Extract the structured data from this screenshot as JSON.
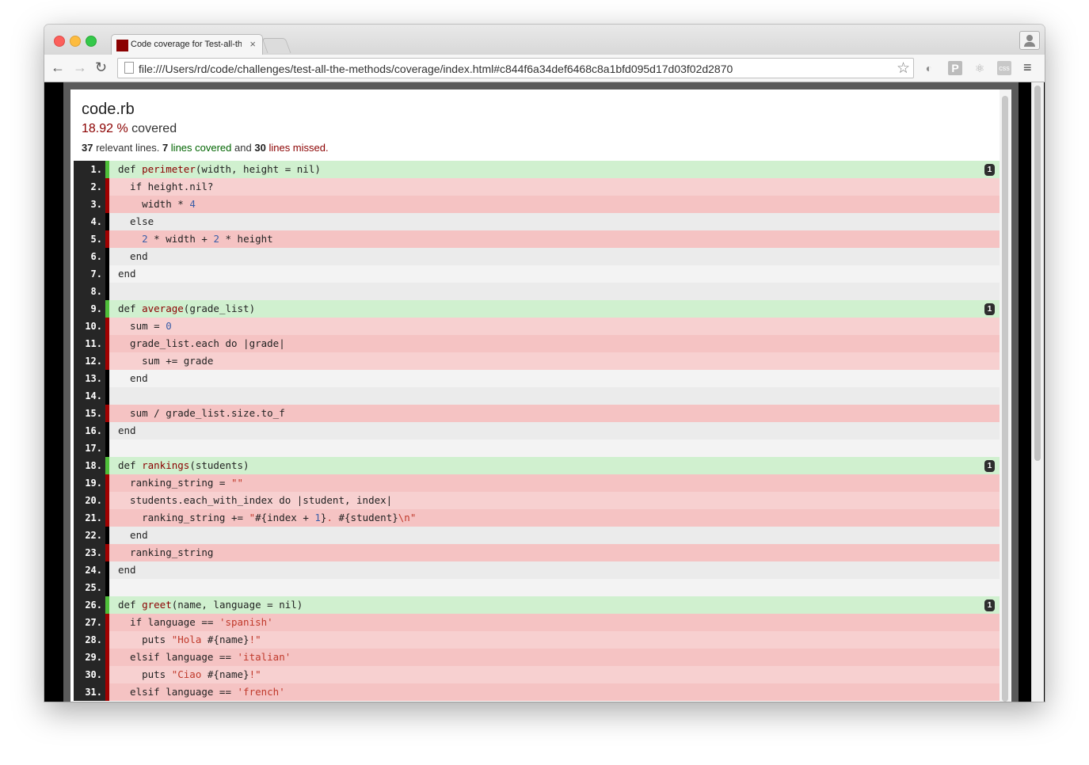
{
  "browser": {
    "tab_title": "Code coverage for Test-all-the-methods",
    "tab_close": "×",
    "url": "file:///Users/rd/code/challenges/test-all-the-methods/coverage/index.html#c844f6a34def6468c8a1bfd095d17d03f02d2870",
    "back": "←",
    "forward": "→",
    "reload": "↻",
    "star": "☆",
    "menu": "≡",
    "ext_opera": "◐",
    "ext_p": "P",
    "ext_react": "⚛",
    "ext_css": "css"
  },
  "report": {
    "file_name": "code.rb",
    "percent": "18.92 %",
    "covered_word": "covered",
    "relevant_count": "37",
    "relevant_text": "relevant lines.",
    "covered_count": "7",
    "covered_text": "lines covered",
    "and_text": "and",
    "missed_count": "30",
    "missed_text": "lines missed."
  },
  "colors": {
    "covered": "#d0f0cf",
    "missed": "#f5c3c3",
    "percent": "#8b0000",
    "covered_text": "#006400"
  },
  "lines": [
    {
      "n": "1.",
      "status": "covered",
      "hits": "1",
      "code": "def <span class=\"kw-fn\">perimeter</span>(width, height = nil)"
    },
    {
      "n": "2.",
      "status": "missed",
      "code": "  if height.nil?"
    },
    {
      "n": "3.",
      "status": "missed",
      "code": "    width * <span class=\"num\">4</span>"
    },
    {
      "n": "4.",
      "status": "never",
      "code": "  else"
    },
    {
      "n": "5.",
      "status": "missed",
      "code": "    <span class=\"num\">2</span> * width + <span class=\"num\">2</span> * height"
    },
    {
      "n": "6.",
      "status": "never",
      "code": "  end"
    },
    {
      "n": "7.",
      "status": "never",
      "code": "end"
    },
    {
      "n": "8.",
      "status": "never",
      "code": ""
    },
    {
      "n": "9.",
      "status": "covered",
      "hits": "1",
      "code": "def <span class=\"kw-fn\">average</span>(grade_list)"
    },
    {
      "n": "10.",
      "status": "missed",
      "code": "  sum = <span class=\"num\">0</span>"
    },
    {
      "n": "11.",
      "status": "missed",
      "code": "  grade_list.each do |grade|"
    },
    {
      "n": "12.",
      "status": "missed",
      "code": "    sum += grade"
    },
    {
      "n": "13.",
      "status": "never",
      "code": "  end"
    },
    {
      "n": "14.",
      "status": "never",
      "code": ""
    },
    {
      "n": "15.",
      "status": "missed",
      "code": "  sum / grade_list.size.to_f"
    },
    {
      "n": "16.",
      "status": "never",
      "code": "end"
    },
    {
      "n": "17.",
      "status": "never",
      "code": ""
    },
    {
      "n": "18.",
      "status": "covered",
      "hits": "1",
      "code": "def <span class=\"kw-fn\">rankings</span>(students)"
    },
    {
      "n": "19.",
      "status": "missed",
      "code": "  ranking_string = <span class=\"str\">\"\"</span>"
    },
    {
      "n": "20.",
      "status": "missed",
      "code": "  students.each_with_index do |student, index|"
    },
    {
      "n": "21.",
      "status": "missed",
      "code": "    ranking_string += <span class=\"str\">\"</span>#{index + <span class=\"num\">1</span>}<span class=\"str\">. </span>#{student}<span class=\"str\">\\n\"</span>"
    },
    {
      "n": "22.",
      "status": "never",
      "code": "  end"
    },
    {
      "n": "23.",
      "status": "missed",
      "code": "  ranking_string"
    },
    {
      "n": "24.",
      "status": "never",
      "code": "end"
    },
    {
      "n": "25.",
      "status": "never",
      "code": ""
    },
    {
      "n": "26.",
      "status": "covered",
      "hits": "1",
      "code": "def <span class=\"kw-fn\">greet</span>(name, language = nil)"
    },
    {
      "n": "27.",
      "status": "missed",
      "code": "  if language == <span class=\"str\">'spanish'</span>"
    },
    {
      "n": "28.",
      "status": "missed",
      "code": "    puts <span class=\"str\">\"Hola </span>#{name}<span class=\"str\">!\"</span>"
    },
    {
      "n": "29.",
      "status": "missed",
      "code": "  elsif language == <span class=\"str\">'italian'</span>"
    },
    {
      "n": "30.",
      "status": "missed",
      "code": "    puts <span class=\"str\">\"Ciao </span>#{name}<span class=\"str\">!\"</span>"
    },
    {
      "n": "31.",
      "status": "missed",
      "code": "  elsif language == <span class=\"str\">'french'</span>"
    }
  ]
}
